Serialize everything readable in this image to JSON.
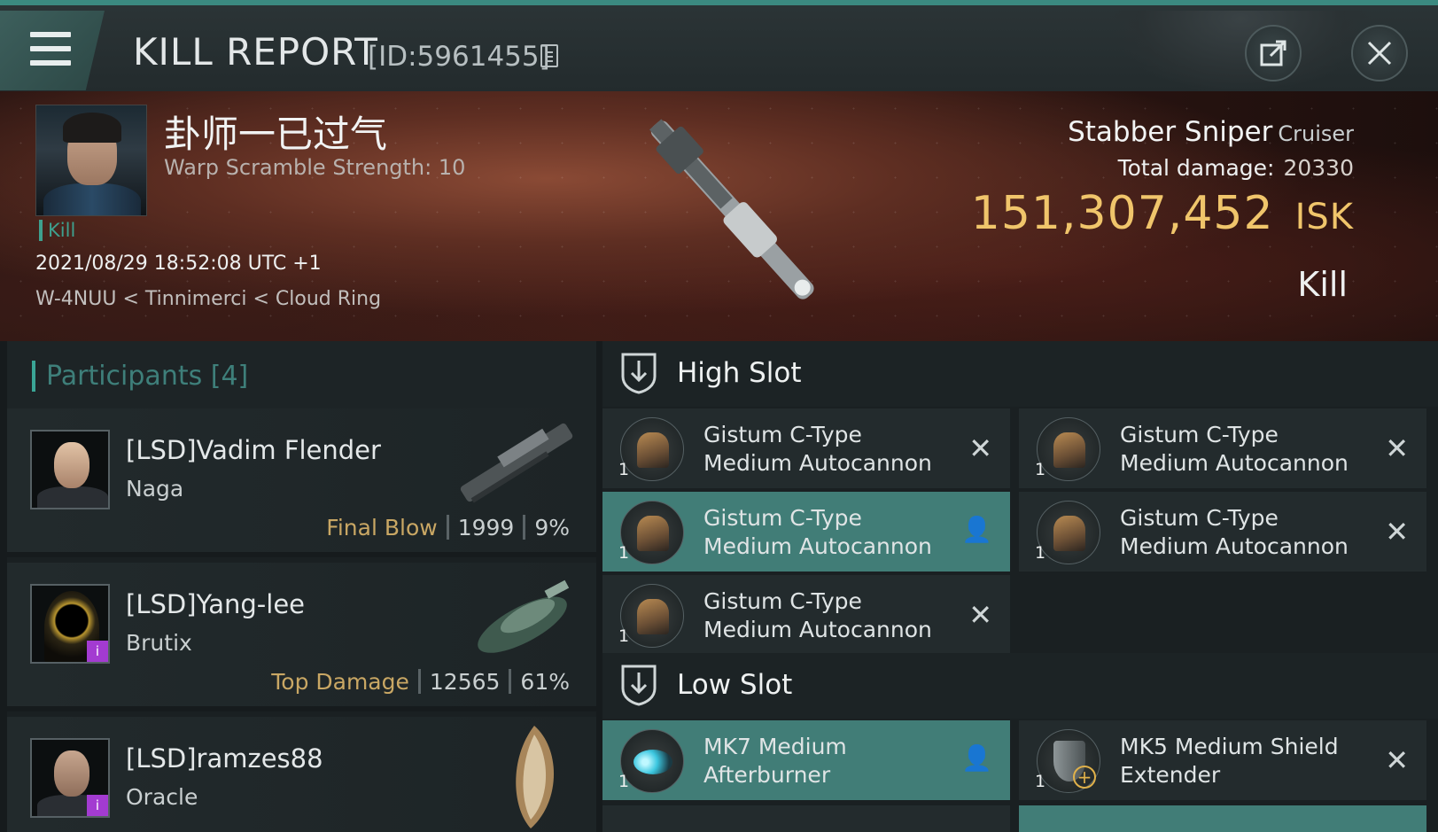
{
  "header": {
    "title": "KILL REPORT",
    "id_label": "[ID:5961455]",
    "menu_icon": "hamburger-icon",
    "share_icon": "share-icon",
    "close_icon": "close-icon"
  },
  "victim": {
    "name": "卦师一已过气",
    "warp": "Warp Scramble Strength: 10",
    "kill_tag": "Kill",
    "date": "2021/08/29 18:52:08 UTC +1",
    "location": "W-4NUU < Tinnimerci < Cloud Ring",
    "ship_name": "Stabber Sniper",
    "ship_class": "Cruiser",
    "total_damage_label": "Total damage:",
    "total_damage_value": "20330",
    "isk_value": "151,307,452",
    "isk_unit": "ISK",
    "result": "Kill"
  },
  "participants": {
    "title": "Participants [4]",
    "items": [
      {
        "name": "[LSD]Vadim Flender",
        "ship": "Naga",
        "tag": "Final Blow",
        "damage": "1999",
        "percent": "9%"
      },
      {
        "name": "[LSD]Yang-lee",
        "ship": "Brutix",
        "tag": "Top Damage",
        "damage": "12565",
        "percent": "61%"
      },
      {
        "name": "[LSD]ramzes88",
        "ship": "Oracle",
        "tag": "",
        "damage": "",
        "percent": ""
      }
    ]
  },
  "high_slot": {
    "label": "High Slot",
    "modules": [
      {
        "name1": "Gistum C-Type",
        "name2": "Medium Autocannon",
        "qty": "1",
        "state": "destroyed"
      },
      {
        "name1": "Gistum C-Type",
        "name2": "Medium Autocannon",
        "qty": "1",
        "state": "destroyed"
      },
      {
        "name1": "Gistum C-Type",
        "name2": "Medium Autocannon",
        "qty": "1",
        "state": "dropped"
      },
      {
        "name1": "Gistum C-Type",
        "name2": "Medium Autocannon",
        "qty": "1",
        "state": "destroyed"
      },
      {
        "name1": "Gistum C-Type",
        "name2": "Medium Autocannon",
        "qty": "1",
        "state": "destroyed"
      }
    ]
  },
  "low_slot": {
    "label": "Low Slot",
    "modules": [
      {
        "name1": "MK7 Medium",
        "name2": "Afterburner",
        "qty": "1",
        "state": "dropped"
      },
      {
        "name1": "MK5 Medium Shield",
        "name2": "Extender",
        "qty": "1",
        "state": "destroyed"
      }
    ]
  },
  "colors": {
    "accent": "#3aa596",
    "isk": "#f0c56b",
    "fitted": "#417d77"
  }
}
